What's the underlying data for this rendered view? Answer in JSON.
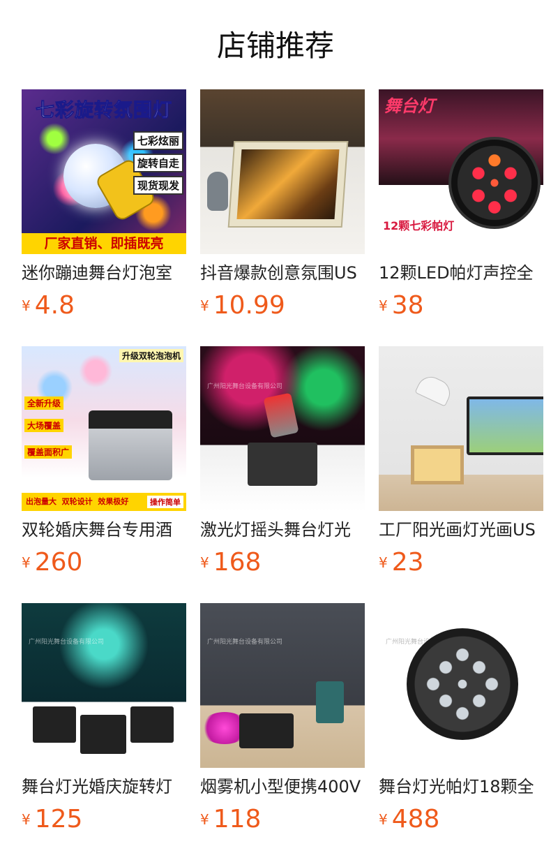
{
  "header": {
    "title": "店铺推荐"
  },
  "currency_symbol": "¥",
  "products": [
    {
      "name": "迷你蹦迪舞台灯泡室",
      "price": "4.8",
      "overlay": {
        "top_banner": "七彩旋转氛围灯",
        "tags": [
          "七彩炫丽",
          "旋转自走",
          "现货现发"
        ],
        "bottom_banner": "厂家直销、即插既亮"
      }
    },
    {
      "name": "抖音爆款创意氛围US",
      "price": "10.99"
    },
    {
      "name": "12颗LED帕灯声控全",
      "price": "38",
      "overlay": {
        "top_text": "舞台灯",
        "bottom_text": "12颗七彩帕灯"
      }
    },
    {
      "name": "双轮婚庆舞台专用酒",
      "price": "260",
      "overlay": {
        "top_tag": "升级双轮泡泡机",
        "tags": [
          "全新升级",
          "大场覆盖",
          "覆盖面积广"
        ],
        "bottom_banner": "出泡量大  双轮设计  效果极好",
        "bottom_tag": "操作简单"
      }
    },
    {
      "name": "激光灯摇头舞台灯光",
      "price": "168",
      "watermark": "广州阳光舞台设备有限公司"
    },
    {
      "name": "工厂阳光画灯光画US",
      "price": "23"
    },
    {
      "name": "舞台灯光婚庆旋转灯",
      "price": "125",
      "watermark": "广州阳光舞台设备有限公司"
    },
    {
      "name": "烟雾机小型便携400V",
      "price": "118",
      "watermark": "广州阳光舞台设备有限公司"
    },
    {
      "name": "舞台灯光帕灯18颗全",
      "price": "488",
      "watermark": "广州阳光舞台设备有限公司"
    }
  ]
}
